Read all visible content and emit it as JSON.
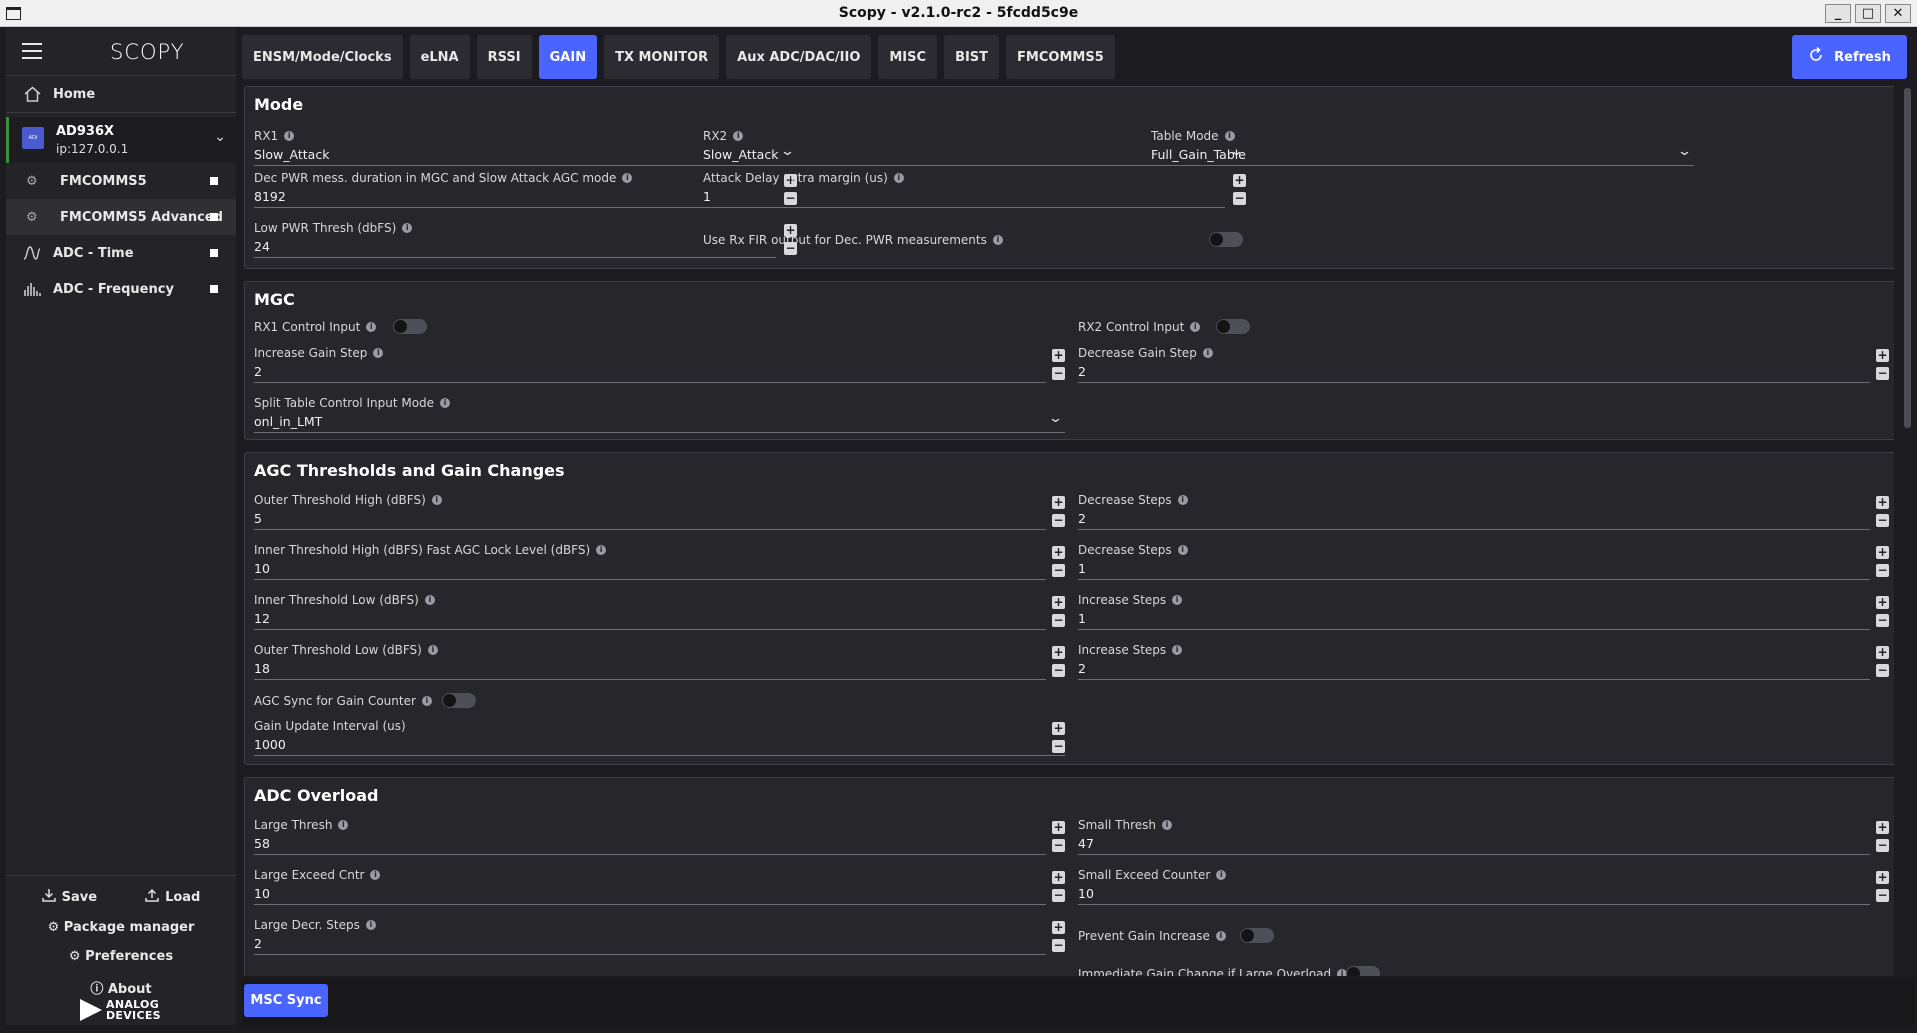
{
  "title": "Scopy - v2.1.0-rc2 - 5fcdd5c9e",
  "window_buttons": [
    "_",
    "□",
    "✕"
  ],
  "sidebar": {
    "logo": "SCOPY",
    "home": "Home",
    "device": {
      "name": "AD936X",
      "ip": "ip:127.0.0.1"
    },
    "items": [
      {
        "label": "FMCOMMS5",
        "icon": "gear-icon"
      },
      {
        "label": "FMCOMMS5 Advanced",
        "icon": "gear-icon"
      },
      {
        "label": "ADC - Time",
        "icon": "waveform-icon"
      },
      {
        "label": "ADC - Frequency",
        "icon": "spectrum-icon"
      }
    ],
    "save": "Save",
    "load": "Load",
    "package_manager": "Package manager",
    "preferences": "Preferences",
    "about": "About",
    "brand_line1": "ANALOG",
    "brand_line2": "DEVICES"
  },
  "tabs": [
    "ENSM/Mode/Clocks",
    "eLNA",
    "RSSI",
    "GAIN",
    "TX MONITOR",
    "Aux ADC/DAC/IIO",
    "MISC",
    "BIST",
    "FMCOMMS5"
  ],
  "active_tab": "GAIN",
  "refresh": "Refresh",
  "mode": {
    "title": "Mode",
    "rx1": {
      "label": "RX1",
      "value": "Slow_Attack"
    },
    "rx2": {
      "label": "RX2",
      "value": "Slow_Attack"
    },
    "table_mode": {
      "label": "Table Mode",
      "value": "Full_Gain_Table"
    },
    "dec_pwr": {
      "label": "Dec PWR mess. duration in MGC and Slow Attack AGC mode",
      "value": "8192"
    },
    "attack_delay": {
      "label": "Attack Delay extra margin (us)",
      "value": "1"
    },
    "low_pwr": {
      "label": "Low PWR Thresh (dbFS)",
      "value": "24"
    },
    "use_rx_fir": {
      "label": "Use Rx FIR output for Dec. PWR measurements",
      "on": false
    }
  },
  "mgc": {
    "title": "MGC",
    "rx1_ctrl": {
      "label": "RX1 Control Input",
      "on": false
    },
    "rx2_ctrl": {
      "label": "RX2 Control Input",
      "on": false
    },
    "inc_step": {
      "label": "Increase Gain Step",
      "value": "2"
    },
    "dec_step": {
      "label": "Decrease Gain Step",
      "value": "2"
    },
    "split_table": {
      "label": "Split Table Control Input Mode",
      "value": "onl_in_LMT"
    }
  },
  "agc": {
    "title": "AGC Thresholds and Gain Changes",
    "outer_high": {
      "label": "Outer Threshold High (dBFS)",
      "value": "5"
    },
    "dec_steps1": {
      "label": "Decrease Steps",
      "value": "2"
    },
    "inner_high": {
      "label": "Inner Threshold High (dBFS) Fast AGC Lock Level (dBFS)",
      "value": "10"
    },
    "dec_steps2": {
      "label": "Decrease Steps",
      "value": "1"
    },
    "inner_low": {
      "label": "Inner Threshold Low (dBFS)",
      "value": "12"
    },
    "inc_steps1": {
      "label": "Increase Steps",
      "value": "1"
    },
    "outer_low": {
      "label": "Outer Threshold Low (dBFS)",
      "value": "18"
    },
    "inc_steps2": {
      "label": "Increase Steps",
      "value": "2"
    },
    "sync": {
      "label": "AGC Sync for Gain Counter",
      "on": false
    },
    "update_interval": {
      "label": "Gain Update Interval (us)",
      "value": "1000"
    }
  },
  "adc": {
    "title": "ADC Overload",
    "large_thresh": {
      "label": "Large Thresh",
      "value": "58"
    },
    "small_thresh": {
      "label": "Small Thresh",
      "value": "47"
    },
    "large_exceed": {
      "label": "Large Exceed Cntr",
      "value": "10"
    },
    "small_exceed": {
      "label": "Small Exceed Counter",
      "value": "10"
    },
    "large_decr": {
      "label": "Large Decr. Steps",
      "value": "2"
    },
    "prevent_gain": {
      "label": "Prevent Gain Increase",
      "on": false
    },
    "immediate": {
      "label": "Immediate Gain Change if Large Overload",
      "on": false
    }
  },
  "msc_sync": "MSC Sync",
  "colors": {
    "accent": "#4a64ff",
    "panel": "#26262b",
    "background": "#1b1b20"
  }
}
